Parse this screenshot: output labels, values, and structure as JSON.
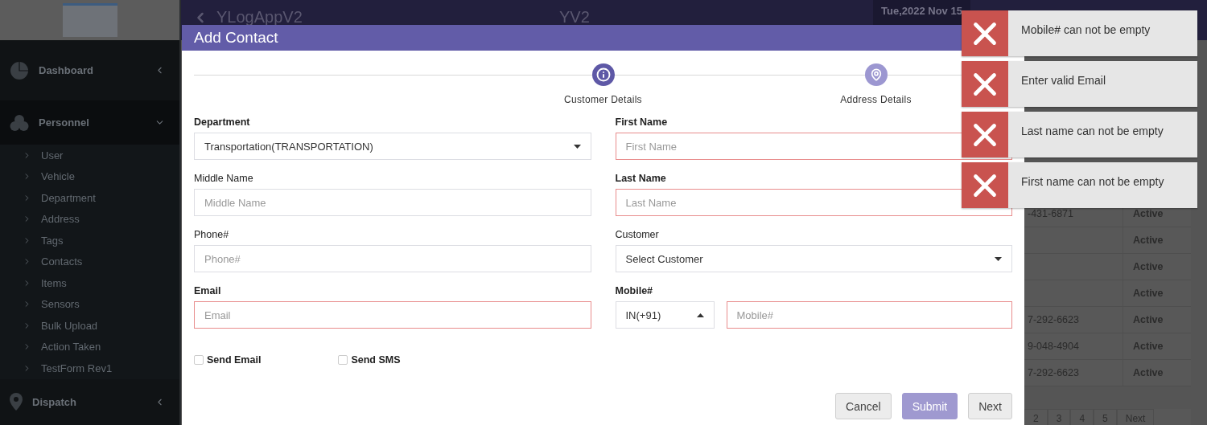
{
  "app": {
    "title": "YLogAppV2",
    "center_title": "YV2",
    "date": "Tue,2022 Nov 15"
  },
  "sidebar": {
    "items": [
      {
        "label": "Dashboard",
        "expanded": false
      },
      {
        "label": "Personnel",
        "expanded": true,
        "children": [
          {
            "label": "User"
          },
          {
            "label": "Vehicle"
          },
          {
            "label": "Department"
          },
          {
            "label": "Address"
          },
          {
            "label": "Tags"
          },
          {
            "label": "Contacts"
          },
          {
            "label": "Items"
          },
          {
            "label": "Sensors"
          },
          {
            "label": "Bulk Upload"
          },
          {
            "label": "Action Taken"
          },
          {
            "label": "TestForm Rev1"
          }
        ]
      },
      {
        "label": "Dispatch",
        "expanded": false
      }
    ]
  },
  "table": {
    "rows": [
      {
        "phone": "-431-6871",
        "status": "Active"
      },
      {
        "status": "Active"
      },
      {
        "status": "Active"
      },
      {
        "status": "Active"
      },
      {
        "phone": "7-292-6623",
        "status": "Active"
      },
      {
        "phone": "9-048-4904",
        "status": "Active"
      },
      {
        "phone": "7-292-6623",
        "status": "Active"
      }
    ],
    "pagination": [
      {
        "label": "2"
      },
      {
        "label": "3"
      },
      {
        "label": "4"
      },
      {
        "label": "5"
      },
      {
        "label": "Next"
      }
    ]
  },
  "modal": {
    "title": "Add Contact",
    "steps": [
      {
        "label": "Customer Details",
        "selected": true
      },
      {
        "label": "Address Details",
        "selected": false
      }
    ],
    "fields": [
      {
        "label": "Department",
        "kind": "select",
        "value": "Transportation(TRANSPORTATION)",
        "required": true,
        "invalid": false
      },
      {
        "label": "First Name",
        "kind": "input",
        "placeholder": "First Name",
        "required": true,
        "invalid": true
      },
      {
        "label": "Middle Name",
        "kind": "input",
        "placeholder": "Middle Name",
        "required": false,
        "invalid": false
      },
      {
        "label": "Last Name",
        "kind": "input",
        "placeholder": "Last Name",
        "required": true,
        "invalid": true
      },
      {
        "label": "Phone#",
        "kind": "input",
        "placeholder": "Phone#",
        "required": false,
        "invalid": false
      },
      {
        "label": "Customer",
        "kind": "select",
        "value": "Select Customer",
        "required": false,
        "invalid": false
      },
      {
        "label": "Email",
        "kind": "input",
        "placeholder": "Email",
        "required": true,
        "invalid": true
      },
      {
        "label": "Mobile#",
        "kind": "phone",
        "country": "IN(+91)",
        "placeholder": "Mobile#",
        "required": true,
        "invalid": true
      }
    ],
    "checkboxes": [
      {
        "label": "Send Email",
        "checked": false
      },
      {
        "label": "Send SMS",
        "checked": false
      }
    ],
    "buttons": [
      {
        "label": "Cancel",
        "kind": "default"
      },
      {
        "label": "Submit",
        "kind": "primary"
      },
      {
        "label": "Next",
        "kind": "default"
      }
    ]
  },
  "toasts": [
    {
      "message": "Mobile# can not be empty"
    },
    {
      "message": "Enter valid Email"
    },
    {
      "message": "Last name can not be empty"
    },
    {
      "message": "First name can not be empty"
    }
  ]
}
